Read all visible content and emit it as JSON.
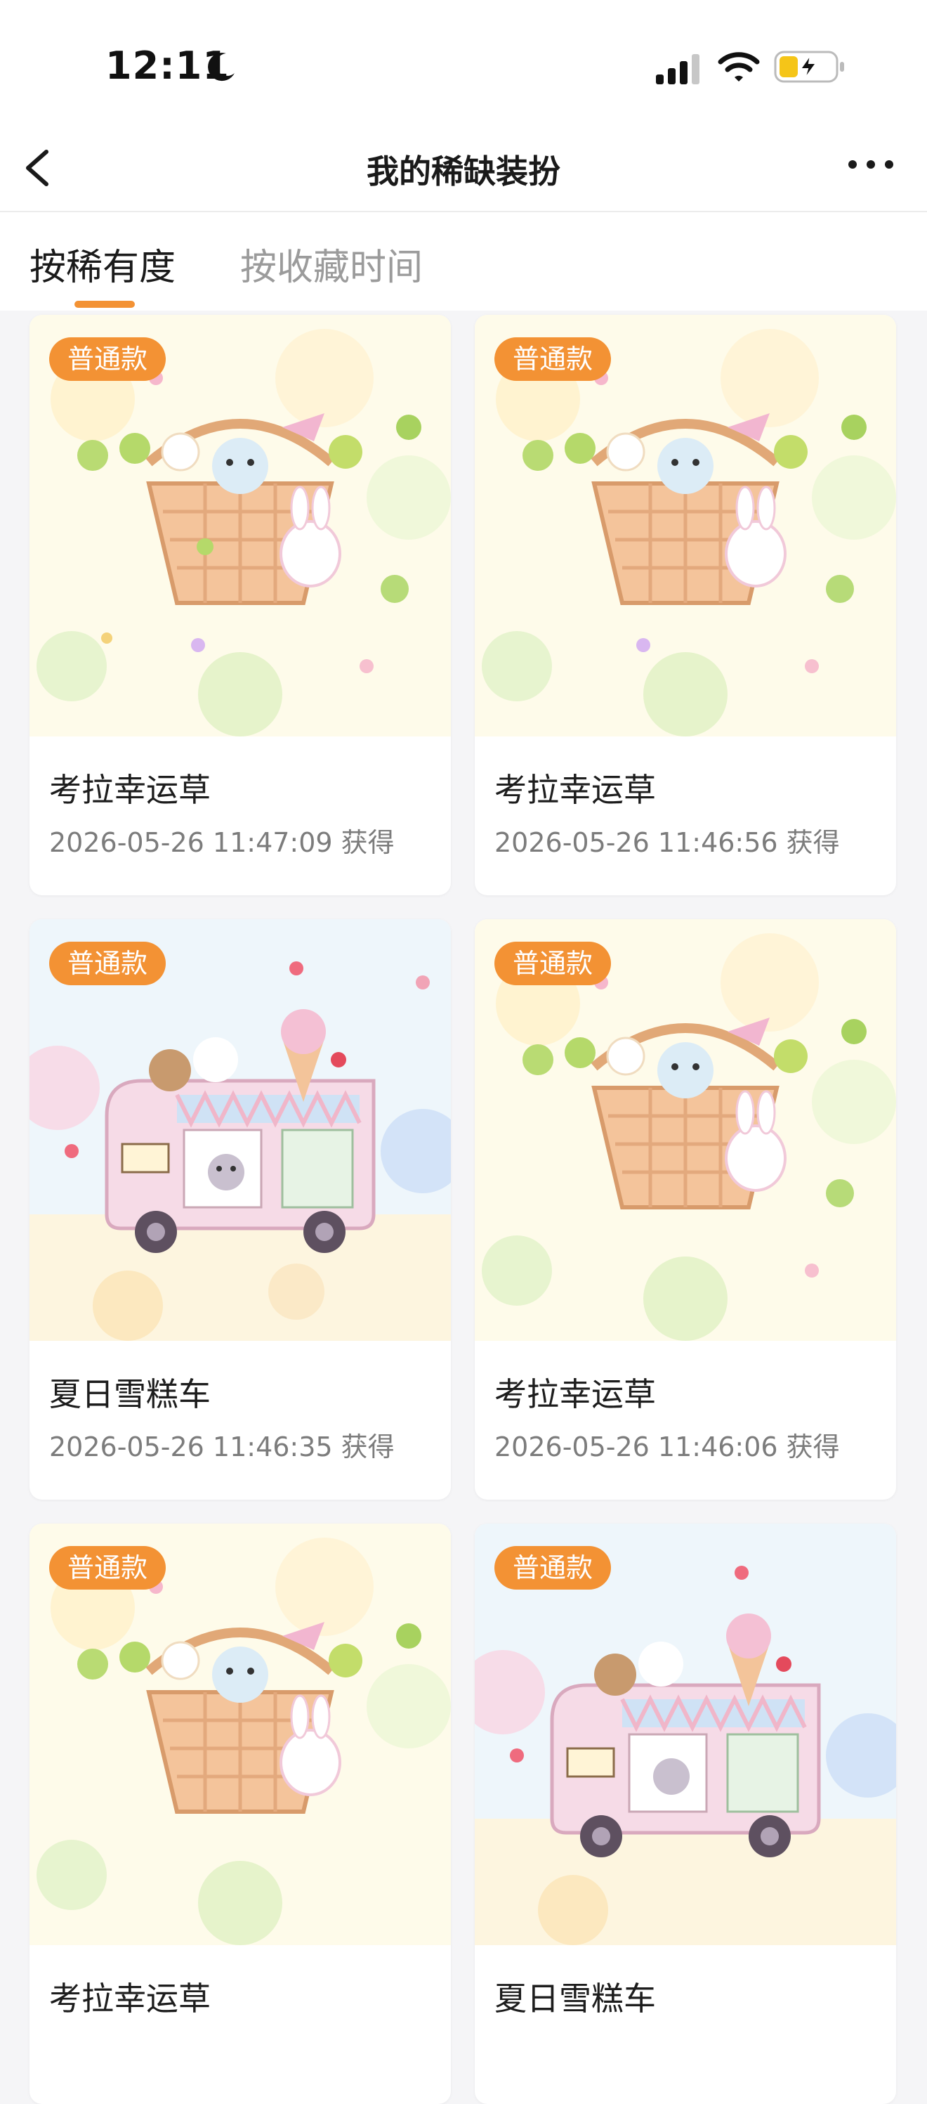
{
  "status_bar": {
    "time": "12:11",
    "moon": "moon-icon",
    "signal": "cellular-signal-icon",
    "wifi": "wifi-icon",
    "battery": "battery-charging-icon"
  },
  "nav": {
    "title": "我的稀缺装扮",
    "back": "back-chevron-icon",
    "more": "more-icon"
  },
  "tabs": [
    {
      "label": "按稀有度",
      "active": true
    },
    {
      "label": "按收藏时间",
      "active": false
    }
  ],
  "colors": {
    "accent": "#f39234",
    "background": "#f5f5f7",
    "card": "#ffffff"
  },
  "items": [
    {
      "badge": "普通款",
      "name": "考拉幸运草",
      "date": "2026-05-26 11:47:09 获得",
      "art": "koala-clover-basket"
    },
    {
      "badge": "普通款",
      "name": "考拉幸运草",
      "date": "2026-05-26 11:46:56 获得",
      "art": "koala-clover-basket"
    },
    {
      "badge": "普通款",
      "name": "夏日雪糕车",
      "date": "2026-05-26 11:46:35 获得",
      "art": "ice-cream-truck"
    },
    {
      "badge": "普通款",
      "name": "考拉幸运草",
      "date": "2026-05-26 11:46:06 获得",
      "art": "koala-clover-basket"
    },
    {
      "badge": "普通款",
      "name": "考拉幸运草",
      "date": "",
      "art": "koala-clover-basket"
    },
    {
      "badge": "普通款",
      "name": "夏日雪糕车",
      "date": "",
      "art": "ice-cream-truck"
    }
  ]
}
